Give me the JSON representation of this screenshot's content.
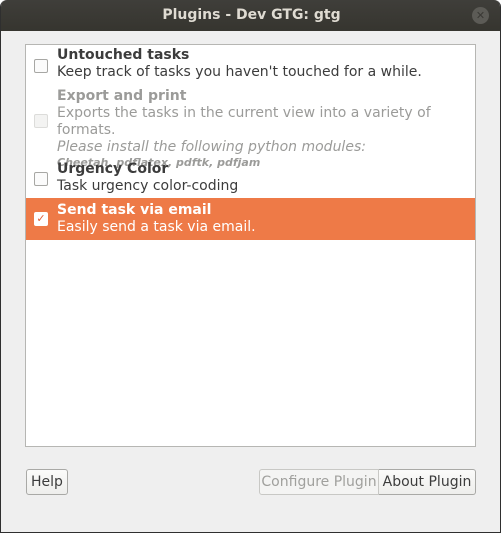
{
  "window": {
    "title": "Plugins - Dev GTG: gtg",
    "close_glyph": "✕"
  },
  "plugins": [
    {
      "name": "Untouched tasks",
      "description": "Keep track of tasks you haven't touched for a while.",
      "enabled": false,
      "state": "normal"
    },
    {
      "name": "Export and print",
      "description": "Exports the tasks in the current view into a variety of formats.",
      "note": "Please install the following python modules:",
      "modules": "Cheetah, pdflatex, pdftk, pdfjam",
      "enabled": false,
      "state": "disabled"
    },
    {
      "name": "Urgency Color",
      "description": "Task urgency color-coding",
      "enabled": false,
      "state": "normal"
    },
    {
      "name": "Send task via email",
      "description": "Easily send a task via email.",
      "enabled": true,
      "state": "selected",
      "check_glyph": "✓"
    }
  ],
  "buttons": {
    "help": "Help",
    "configure": "Configure Plugin",
    "about": "About Plugin"
  },
  "colors": {
    "selection": "#ee7a47",
    "titlebar": "#3a3934",
    "window_bg": "#efefef"
  }
}
